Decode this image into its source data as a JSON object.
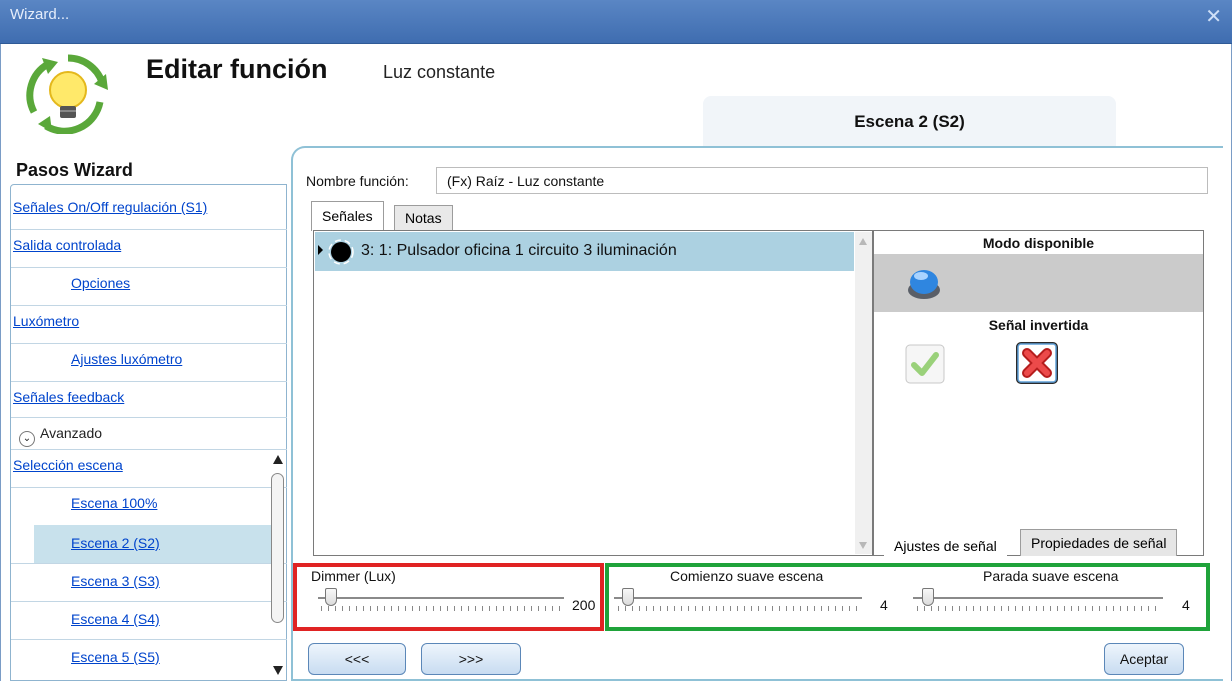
{
  "window": {
    "title": "Wizard..."
  },
  "header": {
    "title": "Editar función",
    "subtitle": "Luz constante",
    "scene_tab": "Escena 2 (S2)"
  },
  "sidebar": {
    "heading": "Pasos Wizard",
    "items": [
      {
        "label": "Señales On/Off regulación (S1)"
      },
      {
        "label": "Salida controlada"
      },
      {
        "label": "Opciones"
      },
      {
        "label": "Luxómetro"
      },
      {
        "label": "Ajustes luxómetro"
      },
      {
        "label": "Señales feedback"
      }
    ],
    "advanced": {
      "label": "Avanzado"
    },
    "scenes": [
      {
        "label": "Selección escena"
      },
      {
        "label": "Escena 100%"
      },
      {
        "label": "Escena 2 (S2)"
      },
      {
        "label": "Escena 3 (S3)"
      },
      {
        "label": "Escena 4 (S4)"
      },
      {
        "label": "Escena 5 (S5)"
      }
    ]
  },
  "form": {
    "name_label": "Nombre función:",
    "name_value": "(Fx) Raíz - Luz constante"
  },
  "tabs": [
    {
      "label": "Señales"
    },
    {
      "label": "Notas"
    }
  ],
  "signals": [
    {
      "label": "3: 1: Pulsador oficina 1 circuito 3 iluminación"
    }
  ],
  "right_panel": {
    "mode_heading": "Modo disponible",
    "inverted_heading": "Señal invertida",
    "tabs": [
      {
        "label": "Ajustes de señal"
      },
      {
        "label": "Propiedades de señal"
      }
    ]
  },
  "sliders": {
    "dimmer": {
      "label": "Dimmer (Lux)",
      "value": "200"
    },
    "start": {
      "label": "Comienzo suave escena",
      "value": "4"
    },
    "stop": {
      "label": "Parada suave escena",
      "value": "4"
    }
  },
  "buttons": {
    "back": "<<<",
    "next": ">>>",
    "accept": "Aceptar"
  },
  "colors": {
    "highlight_red": "#e02323",
    "highlight_green": "#1fa33a",
    "selection": "#acd1e1",
    "titlebar": "#4f7bbd"
  }
}
